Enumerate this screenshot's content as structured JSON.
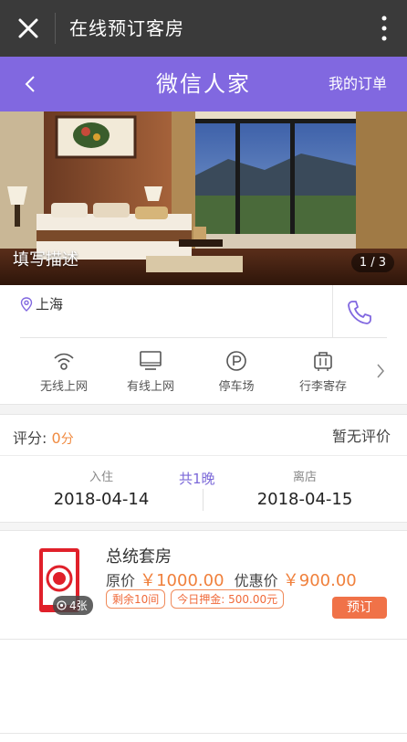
{
  "window": {
    "title": "在线预订客房"
  },
  "header": {
    "title": "微信人家",
    "orders_label": "我的订单"
  },
  "banner": {
    "caption": "填写描述",
    "counter": "1 / 3"
  },
  "location": {
    "city": "上海"
  },
  "amenities": [
    {
      "label": "无线上网",
      "icon": "wifi-icon"
    },
    {
      "label": "有线上网",
      "icon": "monitor-icon"
    },
    {
      "label": "停车场",
      "icon": "parking-icon"
    },
    {
      "label": "行李寄存",
      "icon": "luggage-icon"
    }
  ],
  "rating": {
    "label": "评分:",
    "score": "0",
    "unit": "分",
    "none_text": "暂无评价"
  },
  "dates": {
    "checkin_label": "入住",
    "checkin_value": "2018-04-14",
    "nights": "共1晚",
    "checkout_label": "离店",
    "checkout_value": "2018-04-15"
  },
  "room": {
    "name": "总统套房",
    "original_label": "原价",
    "original_price": "￥1000.00",
    "discount_label": "优惠价",
    "discount_price": "￥900.00",
    "tag_remaining": "剩余10间",
    "tag_deposit": "今日押金: 500.00元",
    "photo_count": "4张",
    "book_label": "预订"
  },
  "colors": {
    "topbar": "#3a3a3a",
    "header": "#8168e0",
    "accent_orange": "#f07248",
    "accent_purple": "#7b68d8"
  }
}
